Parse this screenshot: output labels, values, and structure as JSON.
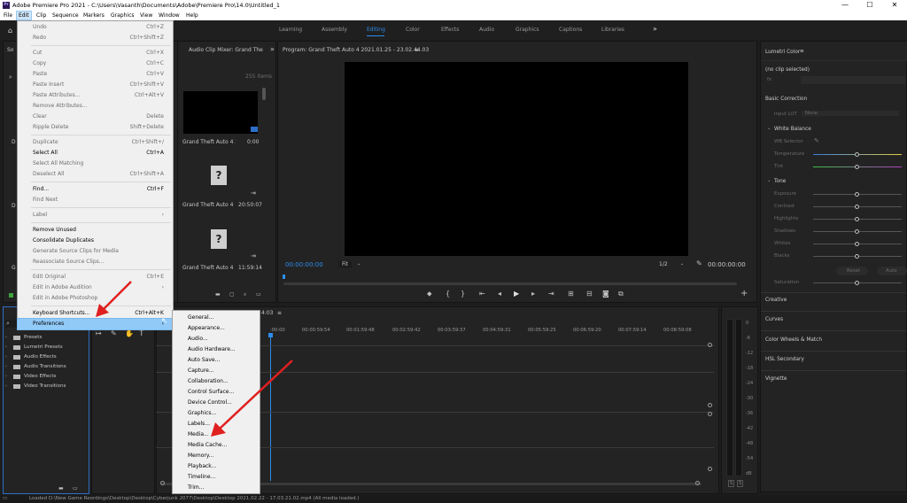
{
  "window": {
    "app_icon": "Pr",
    "title": "Adobe Premiere Pro 2021 - C:\\Users\\Vasanth\\Documents\\Adobe\\Premiere Pro\\14.0\\Untitled_1",
    "minimize": "—",
    "maximize": "☐",
    "close": "✕"
  },
  "menubar": [
    "File",
    "Edit",
    "Clip",
    "Sequence",
    "Markers",
    "Graphics",
    "View",
    "Window",
    "Help"
  ],
  "workspaces": {
    "tabs": [
      "Learning",
      "Assembly",
      "Editing",
      "Color",
      "Effects",
      "Audio",
      "Graphics",
      "Captions",
      "Libraries"
    ],
    "active": "Editing",
    "more": "»"
  },
  "edit_menu": [
    {
      "label": "Undo",
      "shortcut": "Ctrl+Z",
      "disabled": true
    },
    {
      "label": "Redo",
      "shortcut": "Ctrl+Shift+Z",
      "disabled": true
    },
    {
      "sep": true
    },
    {
      "label": "Cut",
      "shortcut": "Ctrl+X",
      "disabled": true
    },
    {
      "label": "Copy",
      "shortcut": "Ctrl+C",
      "disabled": true
    },
    {
      "label": "Paste",
      "shortcut": "Ctrl+V",
      "disabled": true
    },
    {
      "label": "Paste Insert",
      "shortcut": "Ctrl+Shift+V",
      "disabled": true
    },
    {
      "label": "Paste Attributes...",
      "shortcut": "Ctrl+Alt+V",
      "disabled": true
    },
    {
      "label": "Remove Attributes...",
      "shortcut": "",
      "disabled": true
    },
    {
      "label": "Clear",
      "shortcut": "Delete",
      "disabled": true
    },
    {
      "label": "Ripple Delete",
      "shortcut": "Shift+Delete",
      "disabled": true
    },
    {
      "sep": true
    },
    {
      "label": "Duplicate",
      "shortcut": "Ctrl+Shift+/",
      "disabled": true
    },
    {
      "label": "Select All",
      "shortcut": "Ctrl+A",
      "disabled": false
    },
    {
      "label": "Select All Matching",
      "shortcut": "",
      "disabled": true
    },
    {
      "label": "Deselect All",
      "shortcut": "Ctrl+Shift+A",
      "disabled": true
    },
    {
      "sep": true
    },
    {
      "label": "Find...",
      "shortcut": "Ctrl+F",
      "disabled": false
    },
    {
      "label": "Find Next",
      "shortcut": "",
      "disabled": true
    },
    {
      "sep": true
    },
    {
      "label": "Label",
      "shortcut": "›",
      "disabled": true
    },
    {
      "sep": true
    },
    {
      "label": "Remove Unused",
      "shortcut": "",
      "disabled": false
    },
    {
      "label": "Consolidate Duplicates",
      "shortcut": "",
      "disabled": false
    },
    {
      "label": "Generate Source Clips for Media",
      "shortcut": "",
      "disabled": true
    },
    {
      "label": "Reassociate Source Clips...",
      "shortcut": "",
      "disabled": true
    },
    {
      "sep": true
    },
    {
      "label": "Edit Original",
      "shortcut": "Ctrl+E",
      "disabled": true
    },
    {
      "label": "Edit in Adobe Audition",
      "shortcut": "›",
      "disabled": true
    },
    {
      "label": "Edit in Adobe Photoshop",
      "shortcut": "",
      "disabled": true
    },
    {
      "sep": true
    },
    {
      "label": "Keyboard Shortcuts...",
      "shortcut": "Ctrl+Alt+K",
      "disabled": false
    },
    {
      "label": "Preferences",
      "shortcut": "›",
      "disabled": false,
      "highlight": true
    }
  ],
  "preferences_submenu": [
    "General...",
    "Appearance...",
    "Audio...",
    "Audio Hardware...",
    "Auto Save...",
    "Capture...",
    "Collaboration...",
    "Control Surface...",
    "Device Control...",
    "Graphics...",
    "Labels...",
    "Media...",
    "Media Cache...",
    "Memory...",
    "Playback...",
    "Timeline...",
    "Trim..."
  ],
  "audio_mixer": {
    "title": "Audio Clip Mixer: Grand The",
    "items_count": "255 items"
  },
  "media_bin": [
    {
      "name": "Grand Theft Auto 4 2021...",
      "duration": "0:00"
    },
    {
      "name": "Grand Theft Auto 4 ...",
      "duration": "20:50:07"
    },
    {
      "name": "Grand Theft Auto 4 ...",
      "duration": "11:59:14"
    }
  ],
  "program": {
    "title": "Program: Grand Theft Auto 4 2021.01.25 - 23.02.44.03",
    "timecode_left": "00:00:00:00",
    "fit": "Fit",
    "resolution": "1/2",
    "timecode_right": "00:00:00:00"
  },
  "effects_tree": [
    "Presets",
    "Lumetri Presets",
    "Audio Effects",
    "Audio Transitions",
    "Video Effects",
    "Video Transitions"
  ],
  "timeline": {
    "seq_suffix": "4:03",
    "ruler": [
      ":00:00",
      "00:00:59:54",
      "00:01:59:48",
      "00:02:59:42",
      "00:03:59:37",
      "00:04:59:31",
      "00:05:59:25",
      "00:06:59:20",
      "00:07:59:14",
      "00:08:59:08"
    ]
  },
  "meter_scale": [
    "0",
    "-6",
    "-12",
    "-18",
    "-24",
    "-30",
    "-36",
    "-42",
    "-48",
    "-54",
    "dB"
  ],
  "meter_solo": [
    "S",
    "S"
  ],
  "lumetri": {
    "title": "Lumetri Color",
    "clip": "(no clip selected)",
    "fx": "fx",
    "basic_correction": "Basic Correction",
    "input_lut_label": "Input LUT",
    "input_lut_value": "None",
    "white_balance": "White Balance",
    "wb_selector": "WB Selector",
    "temperature": "Temperature",
    "tint": "Tint",
    "tone": "Tone",
    "tone_rows": [
      "Exposure",
      "Contrast",
      "Highlights",
      "Shadows",
      "Whites",
      "Blacks"
    ],
    "reset": "Reset",
    "auto": "Auto",
    "saturation": "Saturation",
    "sections": [
      "Creative",
      "Curves",
      "Color Wheels & Match",
      "HSL Secondary",
      "Vignette"
    ]
  },
  "status": "Loaded D:\\New Game Reordings\\Desktop\\Desktop\\Cyberjunk 2077\\Desktop\\Desktop 2021.02.22 - 17.03.21.02.mp4 (All media loaded.)",
  "colors": {
    "accent": "#2d8ceb",
    "highlight": "#91c9f7",
    "arrow": "#e02020"
  }
}
